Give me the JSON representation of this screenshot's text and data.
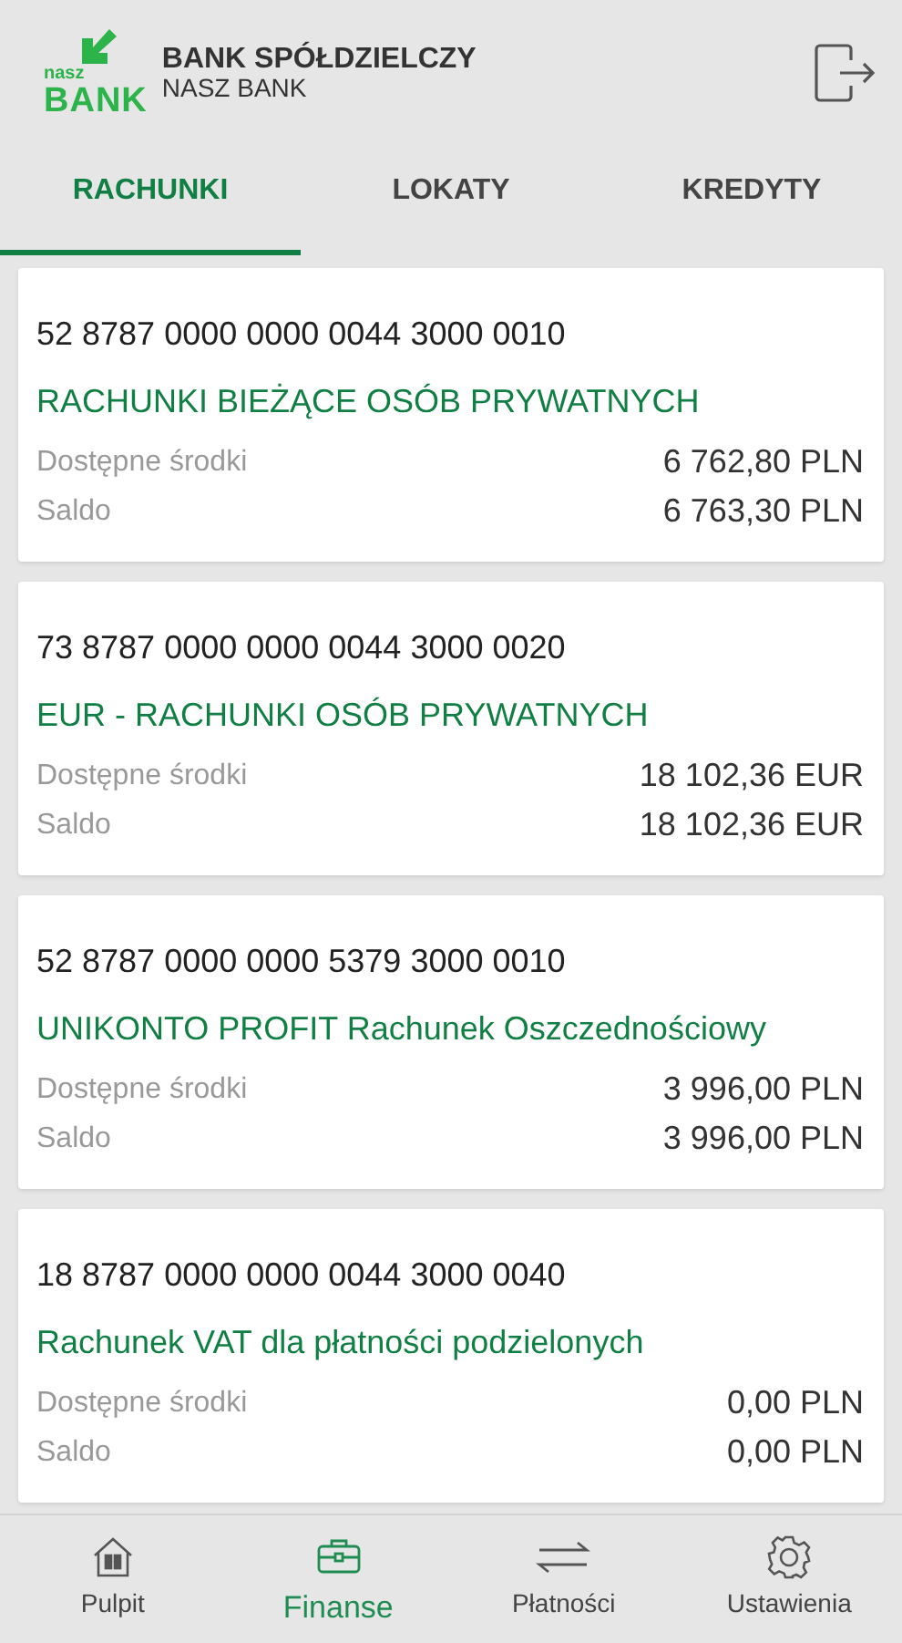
{
  "header": {
    "logo_top": "nasz",
    "logo_bottom": "BANK",
    "title": "BANK SPÓŁDZIELCZY",
    "subtitle": "NASZ BANK"
  },
  "tabs": [
    {
      "label": "RACHUNKI",
      "selected": true
    },
    {
      "label": "LOKATY",
      "selected": false
    },
    {
      "label": "KREDYTY",
      "selected": false
    }
  ],
  "accounts": [
    {
      "number": "52 8787 0000 0000 0044 3000 0010",
      "name": "RACHUNKI BIEŻĄCE OSÓB PRYWATNYCH",
      "rows": [
        {
          "label": "Dostępne środki",
          "value": "6 762,80 PLN"
        },
        {
          "label": "Saldo",
          "value": "6 763,30 PLN"
        }
      ]
    },
    {
      "number": "73 8787 0000 0000 0044 3000 0020",
      "name": "EUR - RACHUNKI OSÓB PRYWATNYCH",
      "rows": [
        {
          "label": "Dostępne środki",
          "value": "18 102,36 EUR"
        },
        {
          "label": "Saldo",
          "value": "18 102,36 EUR"
        }
      ]
    },
    {
      "number": "52 8787 0000 0000 5379 3000 0010",
      "name": "UNIKONTO PROFIT Rachunek Oszczednościowy",
      "rows": [
        {
          "label": "Dostępne środki",
          "value": "3 996,00 PLN"
        },
        {
          "label": "Saldo",
          "value": "3 996,00 PLN"
        }
      ]
    },
    {
      "number": "18 8787 0000 0000 0044 3000 0040",
      "name": "Rachunek VAT dla płatności podzielonych",
      "rows": [
        {
          "label": "Dostępne środki",
          "value": "0,00 PLN"
        },
        {
          "label": "Saldo",
          "value": "0,00 PLN"
        }
      ]
    }
  ],
  "bottom_nav": [
    {
      "label": "Pulpit",
      "selected": false
    },
    {
      "label": "Finanse",
      "selected": true
    },
    {
      "label": "Płatności",
      "selected": false
    },
    {
      "label": "Ustawienia",
      "selected": false
    }
  ]
}
